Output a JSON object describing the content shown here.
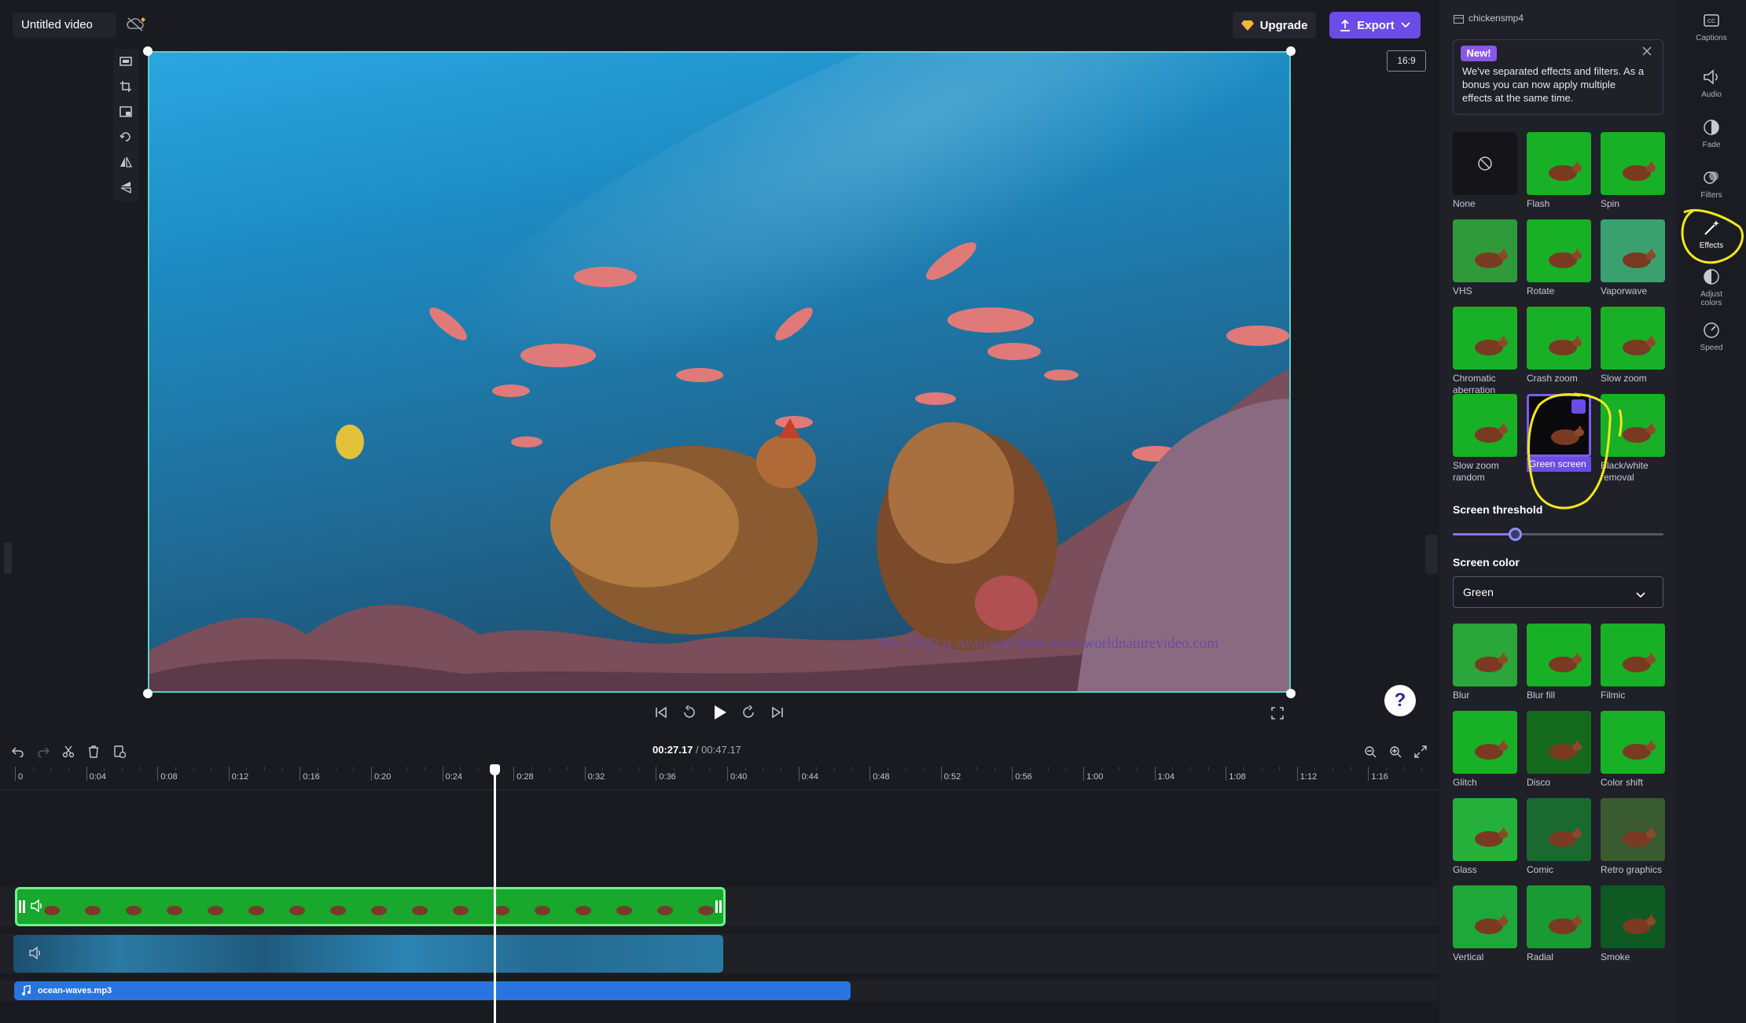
{
  "header": {
    "title": "Untitled video",
    "upgrade_label": "Upgrade",
    "export_label": "Export"
  },
  "preview": {
    "aspect_ratio": "16:9",
    "watermark_text": "This DVD is Available from www.worldnaturevideo.com"
  },
  "help": {
    "label": "?"
  },
  "timeline": {
    "current_time": "00:27.17",
    "total_time": "/ 00:47.17",
    "ticks": [
      "0",
      "0:04",
      "0:08",
      "0:12",
      "0:16",
      "0:20",
      "0:24",
      "0:28",
      "0:32",
      "0:36",
      "0:40",
      "0:44",
      "0:48",
      "0:52",
      "0:56",
      "1:00",
      "1:04",
      "1:08",
      "1:12",
      "1:16"
    ],
    "audio_clip": "ocean-waves.mp3"
  },
  "panel": {
    "file_name": "chickensmp4",
    "notice": {
      "badge": "New!",
      "text": "We've separated effects and filters. As a bonus you can now apply multiple effects at the same time."
    },
    "effects_top": [
      "None",
      "Flash",
      "Spin",
      "VHS",
      "Rotate",
      "Vaporwave",
      "Chromatic aberration",
      "Crash zoom",
      "Slow zoom",
      "Slow zoom random",
      "Green screen",
      "Black/white removal"
    ],
    "threshold_label": "Screen threshold",
    "threshold_value": 0.3,
    "color_label": "Screen color",
    "color_value": "Green",
    "effects_bottom": [
      "Blur",
      "Blur fill",
      "Filmic",
      "Glitch",
      "Disco",
      "Color shift",
      "Glass",
      "Comic",
      "Retro graphics",
      "Vertical",
      "Radial",
      "Smoke"
    ]
  },
  "sidebar": {
    "items": [
      "Captions",
      "Audio",
      "Fade",
      "Filters",
      "Effects",
      "Adjust colors",
      "Speed"
    ]
  },
  "colors": {
    "accent": "#6b4ce6",
    "green_screen": "#17a82c",
    "selection": "#58d0c8",
    "highlight": "#f2e81c"
  }
}
